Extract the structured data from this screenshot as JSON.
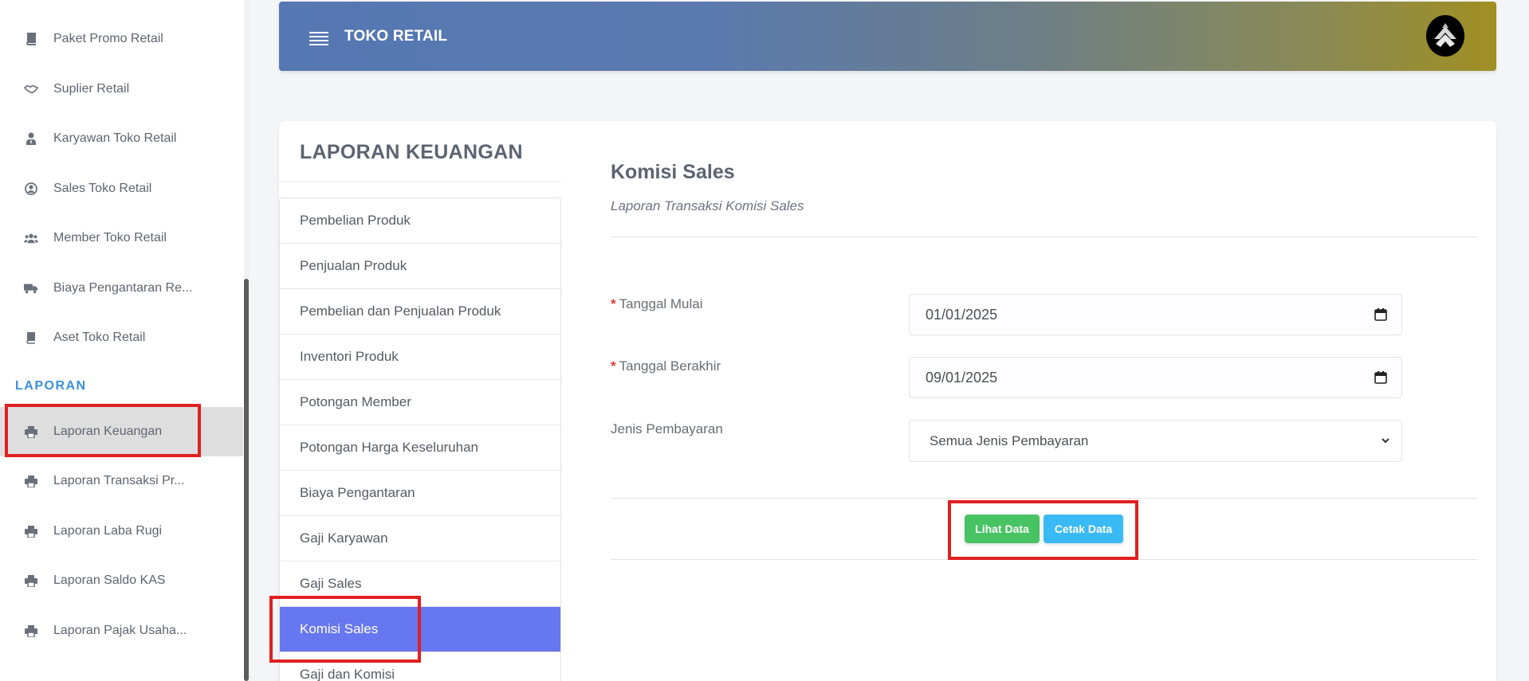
{
  "app": {
    "brand": "TOKO RETAIL"
  },
  "sidebar": {
    "items": [
      {
        "label": "Paket Promo Retail",
        "icon": "book-icon"
      },
      {
        "label": "Suplier Retail",
        "icon": "handshake-icon"
      },
      {
        "label": "Karyawan Toko Retail",
        "icon": "user-tie-icon"
      },
      {
        "label": "Sales Toko Retail",
        "icon": "user-circle-icon"
      },
      {
        "label": "Member Toko Retail",
        "icon": "users-icon"
      },
      {
        "label": "Biaya Pengantaran Re...",
        "icon": "truck-icon"
      },
      {
        "label": "Aset Toko Retail",
        "icon": "book-icon"
      }
    ],
    "section_label": "LAPORAN",
    "report_items": [
      {
        "label": "Laporan Keuangan",
        "icon": "printer-icon",
        "active": true
      },
      {
        "label": "Laporan Transaksi Pr...",
        "icon": "printer-icon"
      },
      {
        "label": "Laporan Laba Rugi",
        "icon": "printer-icon"
      },
      {
        "label": "Laporan Saldo KAS",
        "icon": "printer-icon"
      },
      {
        "label": "Laporan Pajak Usaha...",
        "icon": "printer-icon"
      }
    ]
  },
  "card": {
    "title": "LAPORAN KEUANGAN",
    "menu": [
      {
        "label": "Pembelian Produk"
      },
      {
        "label": "Penjualan Produk"
      },
      {
        "label": "Pembelian dan Penjualan Produk"
      },
      {
        "label": "Inventori Produk"
      },
      {
        "label": "Potongan Member"
      },
      {
        "label": "Potongan Harga Keseluruhan"
      },
      {
        "label": "Biaya Pengantaran"
      },
      {
        "label": "Gaji Karyawan"
      },
      {
        "label": "Gaji Sales"
      },
      {
        "label": "Komisi Sales",
        "active": true
      },
      {
        "label": "Gaji dan Komisi"
      }
    ]
  },
  "report": {
    "title": "Komisi Sales",
    "subtitle": "Laporan Transaksi Komisi Sales",
    "fields": {
      "required_mark": "*",
      "start_label": "Tanggal Mulai",
      "start_value": "01/01/2025",
      "end_label": "Tanggal Berakhir",
      "end_value": "09/01/2025",
      "payment_label": "Jenis Pembayaran",
      "payment_value": "Semua Jenis Pembayaran"
    },
    "buttons": {
      "view": "Lihat Data",
      "print": "Cetak Data"
    }
  },
  "colors": {
    "accent": "#6777ef",
    "success": "#47c363",
    "info": "#3abaf4",
    "section": "#3a8fd9",
    "highlight": "#e02020"
  }
}
